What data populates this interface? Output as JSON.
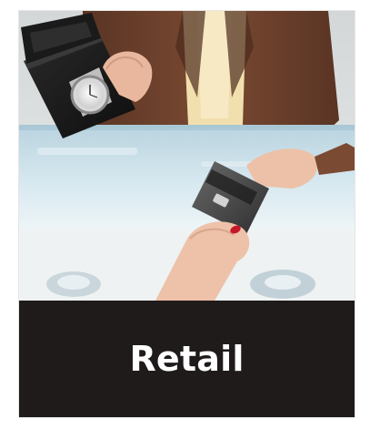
{
  "tile": {
    "label": "Retail",
    "image_subject": "retail-transaction-photo",
    "colors": {
      "caption_background": "#1f1b1b",
      "caption_text": "#ffffff"
    }
  }
}
